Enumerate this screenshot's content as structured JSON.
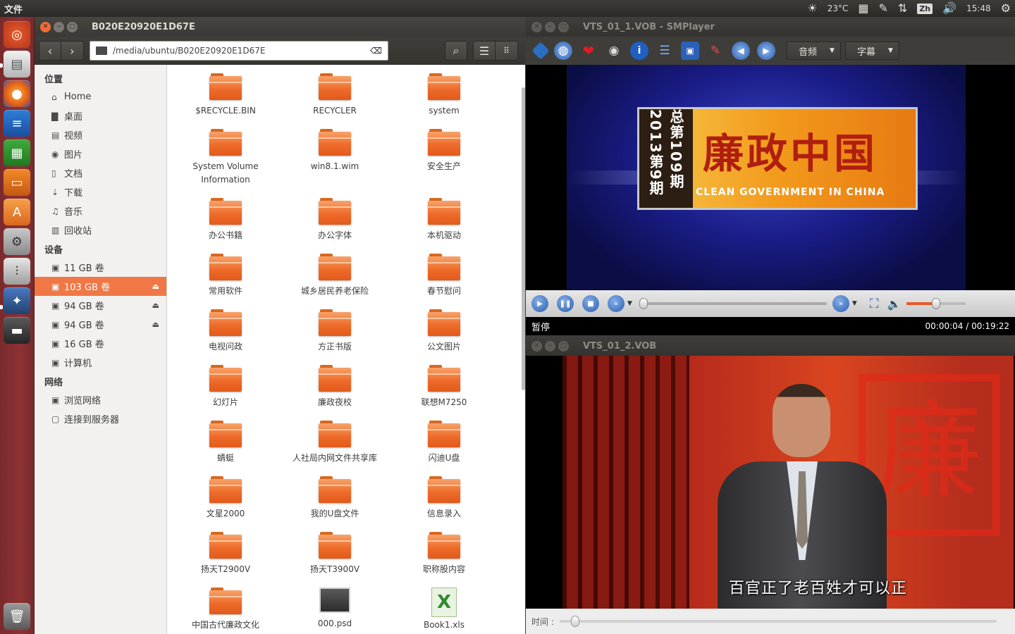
{
  "top_panel": {
    "app_menu": "文件",
    "temperature": "23°C",
    "input_method": "Zh",
    "clock": "15:48"
  },
  "launcher": {
    "items": [
      "ubuntu-dash",
      "files",
      "firefox",
      "writer",
      "calc",
      "impress",
      "software-center",
      "system-settings",
      "equalizer",
      "smplayer",
      "film",
      "trash"
    ]
  },
  "file_manager": {
    "title": "B020E20920E1D67E",
    "path": "/media/ubuntu/B020E20920E1D67E",
    "sidebar": {
      "places_header": "位置",
      "places": [
        {
          "label": "Home",
          "icon": "home-icon"
        },
        {
          "label": "桌面",
          "icon": "folder-icon"
        },
        {
          "label": "视频",
          "icon": "video-icon"
        },
        {
          "label": "图片",
          "icon": "camera-icon"
        },
        {
          "label": "文档",
          "icon": "document-icon"
        },
        {
          "label": "下载",
          "icon": "download-icon"
        },
        {
          "label": "音乐",
          "icon": "music-icon"
        },
        {
          "label": "回收站",
          "icon": "trash-icon"
        }
      ],
      "devices_header": "设备",
      "devices": [
        {
          "label": "11 GB 卷",
          "eject": false,
          "active": false
        },
        {
          "label": "103 GB 卷",
          "eject": true,
          "active": true
        },
        {
          "label": "94 GB 卷",
          "eject": true,
          "active": false
        },
        {
          "label": "94 GB 卷",
          "eject": true,
          "active": false
        },
        {
          "label": "16 GB 卷",
          "eject": false,
          "active": false
        },
        {
          "label": "计算机",
          "eject": false,
          "active": false
        }
      ],
      "network_header": "网络",
      "network": [
        {
          "label": "浏览网络",
          "icon": "network-icon"
        },
        {
          "label": "连接到服务器",
          "icon": "server-icon"
        }
      ]
    },
    "files": [
      {
        "name": "$RECYCLE.BIN",
        "type": "folder"
      },
      {
        "name": "RECYCLER",
        "type": "folder"
      },
      {
        "name": "system",
        "type": "folder"
      },
      {
        "name": "System Volume Information",
        "type": "folder"
      },
      {
        "name": "win8.1.wim",
        "type": "folder"
      },
      {
        "name": "安全生产",
        "type": "folder"
      },
      {
        "name": "办公书籍",
        "type": "folder"
      },
      {
        "name": "办公字体",
        "type": "folder"
      },
      {
        "name": "本机驱动",
        "type": "folder"
      },
      {
        "name": "常用软件",
        "type": "folder"
      },
      {
        "name": "城乡居民养老保险",
        "type": "folder"
      },
      {
        "name": "春节慰问",
        "type": "folder"
      },
      {
        "name": "电视问政",
        "type": "folder"
      },
      {
        "name": "方正书版",
        "type": "folder"
      },
      {
        "name": "公文图片",
        "type": "folder"
      },
      {
        "name": "幻灯片",
        "type": "folder"
      },
      {
        "name": "廉政夜校",
        "type": "folder"
      },
      {
        "name": "联想M7250",
        "type": "folder"
      },
      {
        "name": "蜻蜓",
        "type": "folder"
      },
      {
        "name": "人社局内网文件共享库",
        "type": "folder"
      },
      {
        "name": "闪迪U盘",
        "type": "folder"
      },
      {
        "name": "文星2000",
        "type": "folder"
      },
      {
        "name": "我的U盘文件",
        "type": "folder"
      },
      {
        "name": "信息录入",
        "type": "folder"
      },
      {
        "name": "扬天T2900V",
        "type": "folder"
      },
      {
        "name": "扬天T3900V",
        "type": "folder"
      },
      {
        "name": "职称股内容",
        "type": "folder"
      },
      {
        "name": "中国古代廉政文化",
        "type": "folder"
      },
      {
        "name": "000.psd",
        "type": "psd"
      },
      {
        "name": "Book1.xls",
        "type": "xls"
      }
    ]
  },
  "player1": {
    "title": "VTS_01_1.VOB - SMPlayer",
    "audio_combo": "音频",
    "subtitle_combo": "字幕",
    "status": "暂停",
    "time": "00:00:04 / 00:19:22",
    "progress_fraction": 0.004,
    "volume_fraction": 0.5,
    "video_issue_text": "总第109期 2013第9期",
    "video_title_cn": "廉政中国",
    "video_title_en": "CLEAN GOVERNMENT IN CHINA"
  },
  "player2": {
    "title": "VTS_01_2.VOB",
    "seek_label": "时间 :",
    "subtitle_text": "百官正了老百姓才可以正",
    "seal_char": "廉"
  }
}
